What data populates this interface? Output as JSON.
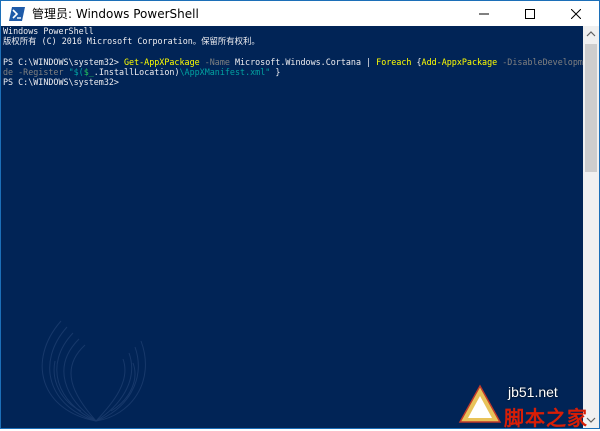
{
  "window": {
    "title": "管理员: Windows PowerShell",
    "icon": "powershell-icon",
    "controls": {
      "minimize": "minimize-icon",
      "maximize": "maximize-icon",
      "close": "close-icon"
    }
  },
  "console": {
    "background_color": "#012456",
    "text_color": "#eeedf0",
    "line1": "Windows PowerShell",
    "line2": "版权所有 (C) 2016 Microsoft Corporation。保留所有权利。",
    "line3": "",
    "prompt1": "PS C:\\WINDOWS\\system32> ",
    "cmd_get": "Get-AppXPackage",
    "param_name": " -Name ",
    "arg_name": "Microsoft.Windows.Cortana",
    "pipe": " | ",
    "cmd_foreach": "Foreach",
    "brace_open": " {",
    "cmd_add": "Add-AppxPackage",
    "param_disable_1": " -DisableDevelopmentMo",
    "param_disable_2": "de",
    "param_register": " -Register ",
    "str_open": "\"$(",
    "var_underscore": "$_",
    "member": ".InstallLocation)",
    "str_tail": "\\AppXManifest.xml\"",
    "brace_close": "}",
    "prompt2": "PS C:\\WINDOWS\\system32>"
  },
  "scrollbar": {
    "up_icon": "chevron-up-icon",
    "down_icon": "chevron-down-icon"
  },
  "watermark": {
    "url": "jb51.net",
    "name": "脚本之家"
  }
}
